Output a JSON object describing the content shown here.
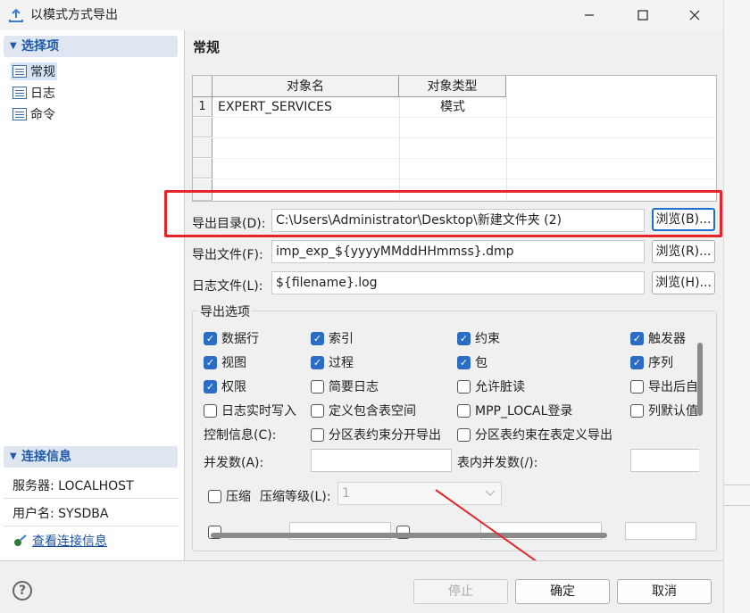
{
  "window": {
    "title": "以模式方式导出"
  },
  "left": {
    "section_select": "选择项",
    "nav": [
      {
        "label": "常规"
      },
      {
        "label": "日志"
      },
      {
        "label": "命令"
      }
    ],
    "section_conn": "连接信息",
    "server": "服务器: LOCALHOST",
    "user": "用户名: SYSDBA",
    "view_conn": "查看连接信息"
  },
  "main": {
    "title": "常规",
    "table": {
      "headers": [
        "对象名",
        "对象类型"
      ],
      "rows": [
        {
          "num": "1",
          "name": "EXPERT_SERVICES",
          "type": "模式"
        }
      ]
    },
    "export_dir_label": "导出目录(D):",
    "export_dir_value": "C:\\Users\\Administrator\\Desktop\\新建文件夹 (2)",
    "export_file_label": "导出文件(F):",
    "export_file_value": "imp_exp_${yyyyMMddHHmmss}.dmp",
    "log_file_label": "日志文件(L):",
    "log_file_value": "${filename}.log",
    "browse_b": "浏览(B)...",
    "browse_r": "浏览(R)...",
    "browse_h": "浏览(H)...",
    "options": {
      "title": "导出选项",
      "items": [
        {
          "label": "数据行",
          "checked": true
        },
        {
          "label": "索引",
          "checked": true
        },
        {
          "label": "约束",
          "checked": true
        },
        {
          "label": "触发器",
          "checked": true
        },
        {
          "label": "视图",
          "checked": true
        },
        {
          "label": "过程",
          "checked": true
        },
        {
          "label": "包",
          "checked": true
        },
        {
          "label": "序列",
          "checked": true
        },
        {
          "label": "权限",
          "checked": true
        },
        {
          "label": "简要日志",
          "checked": false
        },
        {
          "label": "允许脏读",
          "checked": false
        },
        {
          "label": "导出后自",
          "checked": false
        },
        {
          "label": "日志实时写入",
          "checked": false
        },
        {
          "label": "定义包含表空间",
          "checked": false
        },
        {
          "label": "MPP_LOCAL登录",
          "checked": false
        },
        {
          "label": "列默认值",
          "checked": false
        }
      ],
      "control_info_label": "控制信息(C):",
      "partition_split": "分区表约束分开导出",
      "partition_in_def": "分区表约束在表定义导出",
      "parallel_label": "并发数(A):",
      "in_table_parallel_label": "表内并发数(/):",
      "compress_label": "压缩",
      "compress_level_label": "压缩等级(L):",
      "compress_level_value": "1"
    }
  },
  "buttons": {
    "stop": "停止",
    "ok": "确定",
    "cancel": "取消"
  }
}
